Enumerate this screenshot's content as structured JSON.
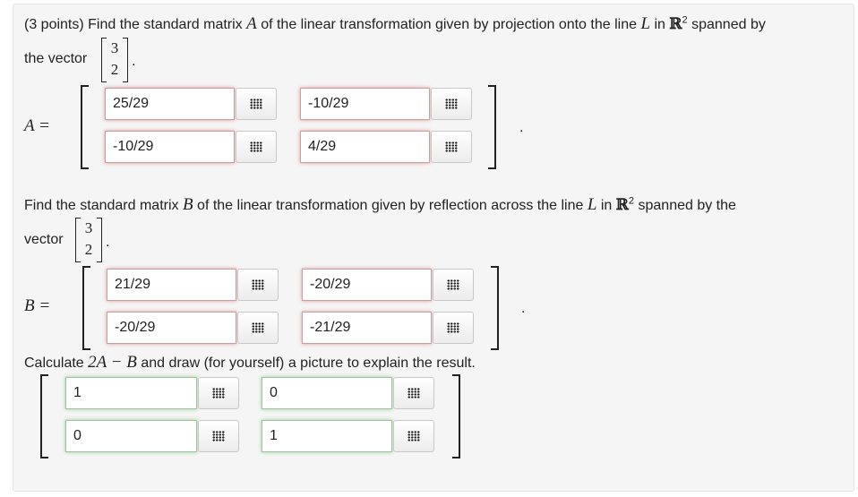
{
  "q1": {
    "prefix": "(3 points) Find the standard matrix",
    "sym_A": "A",
    "mid": "of the linear transformation given by projection onto the line",
    "sym_L": "L",
    "in": "in",
    "R": "ℝ",
    "exp": "2",
    "suffix": "spanned by",
    "line2": "the vector",
    "vec": [
      "3",
      "2"
    ],
    "lhs": "A =",
    "inputs": [
      "25/29",
      "-10/29",
      "-10/29",
      "4/29"
    ]
  },
  "q2": {
    "prefix": "Find the standard matrix",
    "sym_B": "B",
    "mid": "of the linear transformation given by reflection across the line",
    "sym_L": "L",
    "in": "in",
    "R": "ℝ",
    "exp": "2",
    "suffix": "spanned by the",
    "line2": "vector",
    "vec": [
      "3",
      "2"
    ],
    "lhs": "B =",
    "inputs": [
      "21/29",
      "-20/29",
      "-20/29",
      "-21/29"
    ]
  },
  "q3": {
    "prefix": "Calculate",
    "expr": "2A − B",
    "suffix": "and draw (for yourself) a picture to explain the result.",
    "inputs": [
      "1",
      "0",
      "0",
      "1"
    ]
  },
  "period": ".",
  "icons": {
    "matrix_button": "grid-dots-icon"
  },
  "colors": {
    "incorrect_glow": "#cc2828",
    "correct_glow": "#329632",
    "panel_bg": "#f5f5f5"
  }
}
